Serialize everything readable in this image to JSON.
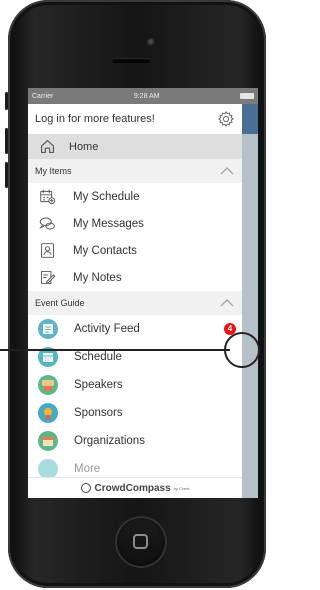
{
  "status_bar": {
    "carrier": "Carrier",
    "time": "9:28 AM"
  },
  "menu": {
    "login_prompt": "Log in for more features!",
    "home_label": "Home",
    "sections": {
      "my_items": {
        "title": "My Items",
        "items": [
          {
            "label": "My Schedule",
            "icon": "calendar-add-icon"
          },
          {
            "label": "My Messages",
            "icon": "messages-icon"
          },
          {
            "label": "My Contacts",
            "icon": "contacts-icon"
          },
          {
            "label": "My Notes",
            "icon": "notes-icon"
          }
        ]
      },
      "event_guide": {
        "title": "Event Guide",
        "items": [
          {
            "label": "Activity Feed",
            "icon": "activity-feed-icon",
            "color": "#5fb4c8"
          },
          {
            "label": "Schedule",
            "icon": "schedule-icon",
            "color": "#4fb8c0"
          },
          {
            "label": "Speakers",
            "icon": "speakers-icon",
            "color": "#5cb78a"
          },
          {
            "label": "Sponsors",
            "icon": "sponsors-icon",
            "color": "#46a9c5"
          },
          {
            "label": "Organizations",
            "icon": "organizations-icon",
            "color": "#5cb78a"
          },
          {
            "label": "More",
            "icon": "more-icon",
            "color": "#4fb8c0"
          }
        ]
      }
    },
    "activity_badge": "4",
    "footer_brand": "CrowdCompass",
    "footer_small": "by Cvent"
  },
  "colors": {
    "badge": "#e11111",
    "main_header": "#4a6f95",
    "status_bar": "#7a7a7a"
  }
}
